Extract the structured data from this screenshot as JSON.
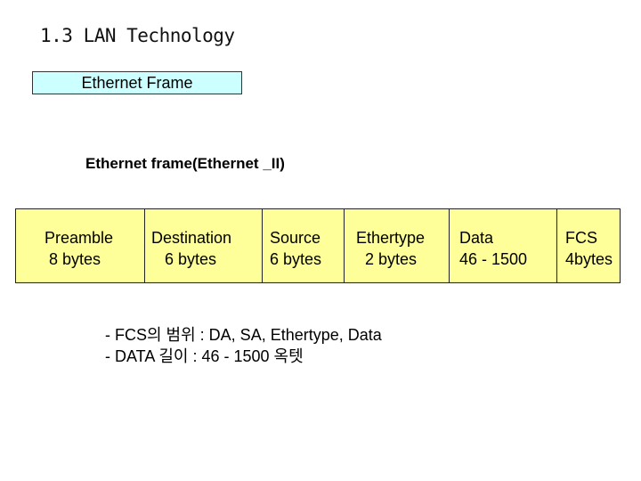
{
  "slide": {
    "title": "1.3 LAN Technology",
    "subtitle": "Ethernet Frame",
    "heading": "Ethernet frame(Ethernet _II)"
  },
  "frame_fields": [
    {
      "name": "Preamble",
      "size": " 8 bytes"
    },
    {
      "name": "Destination",
      "size": "   6 bytes"
    },
    {
      "name": "Source",
      "size": "6 bytes"
    },
    {
      "name": "Ethertype",
      "size": "  2 bytes"
    },
    {
      "name": "Data",
      "size": "46 - 1500"
    },
    {
      "name": "FCS",
      "size": "4bytes"
    }
  ],
  "notes": [
    "- FCS의 범위 : DA, SA, Ethertype, Data",
    "- DATA 길이 : 46 - 1500 옥텟"
  ],
  "colors": {
    "subtitle_fill": "#ccffff",
    "frame_fill": "#ffff99"
  }
}
